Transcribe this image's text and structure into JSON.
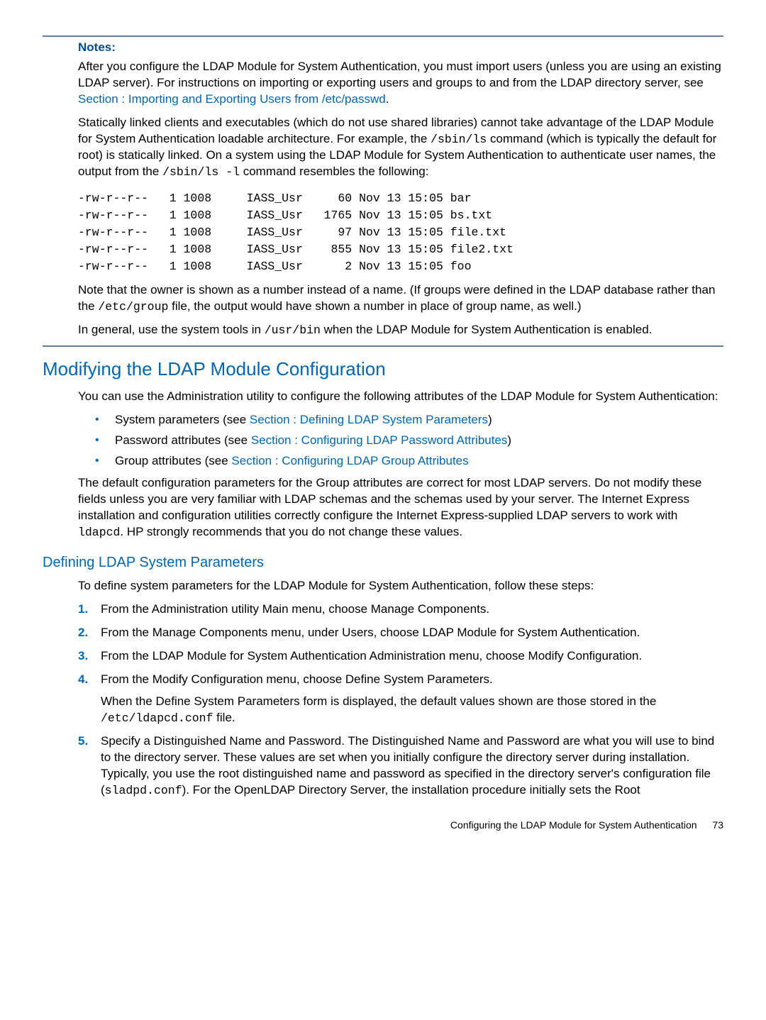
{
  "notes": {
    "label": "Notes:",
    "p1_a": "After you configure the LDAP Module for System Authentication, you must import users (unless you are using an existing LDAP server). For instructions on importing or exporting users and groups to and from the LDAP directory server, see ",
    "p1_link": "Section : Importing and Exporting Users from /etc/passwd",
    "p1_c": ".",
    "p2_a": "Statically linked clients and executables (which do not use shared libraries) cannot take advantage of the LDAP Module for System Authentication loadable architecture. For example, the ",
    "p2_code1": "/sbin/ls",
    "p2_b": " command (which is typically the default for root) is statically linked. On a system using the LDAP Module for System Authentication to authenticate user names, the output from the ",
    "p2_code2": "/sbin/ls -l",
    "p2_c": " command resembles the following:",
    "code": "-rw-r--r--   1 1008     IASS_Usr     60 Nov 13 15:05 bar\n-rw-r--r--   1 1008     IASS_Usr   1765 Nov 13 15:05 bs.txt\n-rw-r--r--   1 1008     IASS_Usr     97 Nov 13 15:05 file.txt\n-rw-r--r--   1 1008     IASS_Usr    855 Nov 13 15:05 file2.txt\n-rw-r--r--   1 1008     IASS_Usr      2 Nov 13 15:05 foo",
    "p3_a": "Note that the owner is shown as a number instead of a name. (If groups were defined in the LDAP database rather than the ",
    "p3_code": "/etc/group",
    "p3_b": " file, the output would have shown a number in place of group name, as well.)",
    "p4_a": "In general, use the system tools in ",
    "p4_code": "/usr/bin",
    "p4_b": " when the LDAP Module for System Authentication is enabled."
  },
  "mod": {
    "title": "Modifying the LDAP Module Configuration",
    "intro": "You can use the Administration utility to configure the following attributes of the LDAP Module for System Authentication:",
    "b1_a": "System parameters (see ",
    "b1_link": "Section : Defining LDAP System Parameters",
    "b1_c": ")",
    "b2_a": "Password attributes (see ",
    "b2_link": "Section : Configuring LDAP Password Attributes",
    "b2_c": ")",
    "b3_a": "Group attributes (see ",
    "b3_link": "Section : Configuring LDAP Group Attributes",
    "p2_a": "The default configuration parameters for the Group attributes are correct for most LDAP servers. Do not modify these fields unless you are very familiar with LDAP schemas and the schemas used by your server. The Internet Express installation and configuration utilities correctly configure the Internet Express-supplied LDAP servers to work with ",
    "p2_code": "ldapcd",
    "p2_b": ". HP strongly recommends that you do not change these values."
  },
  "def": {
    "title": "Defining LDAP System Parameters",
    "intro": "To define system parameters for the LDAP Module for System Authentication, follow these steps:",
    "s1": "From the Administration utility Main menu, choose Manage Components.",
    "s2": "From the Manage Components menu, under Users, choose LDAP Module for System Authentication.",
    "s3": "From the LDAP Module for System Authentication Administration menu, choose Modify Configuration.",
    "s4a": "From the Modify Configuration menu, choose Define System Parameters.",
    "s4b_a": "When the Define System Parameters form is displayed, the default values shown are those stored in the ",
    "s4b_code": "/etc/ldapcd.conf",
    "s4b_b": " file.",
    "s5_a": "Specify a Distinguished Name and Password. The Distinguished Name and Password are what you will use to bind to the directory server. These values are set when you initially configure the directory server during installation. Typically, you use the root distinguished name and password as specified in the directory server's configuration file (",
    "s5_code": "sladpd.conf",
    "s5_b": "). For the OpenLDAP Directory Server, the installation procedure initially sets the Root"
  },
  "footer": {
    "text": "Configuring the LDAP Module for System Authentication",
    "page": "73"
  }
}
